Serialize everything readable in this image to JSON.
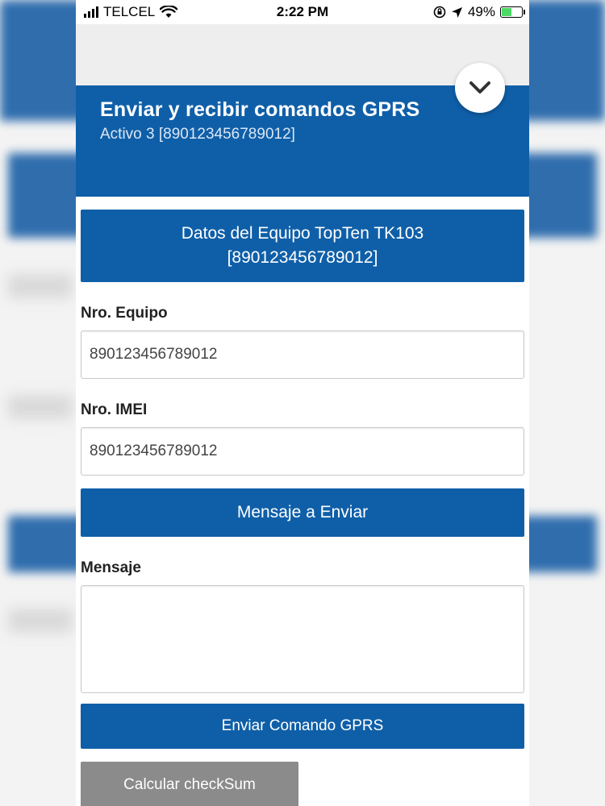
{
  "status_bar": {
    "carrier": "TELCEL",
    "time": "2:22 PM",
    "battery_percent": "49%",
    "battery_level": 0.49,
    "icons": [
      "signal-icon",
      "wifi-icon",
      "rotation-lock-icon",
      "location-icon",
      "battery-icon"
    ]
  },
  "modal": {
    "title": "Enviar y recibir comandos GPRS",
    "subtitle": "Activo 3 [890123456789012]",
    "collapse_icon": "chevron-down-icon"
  },
  "device_header": {
    "line1": "Datos del Equipo TopTen TK103",
    "line2": "[890123456789012]"
  },
  "fields": {
    "equipo_label": "Nro. Equipo",
    "equipo_value": "890123456789012",
    "imei_label": "Nro. IMEI",
    "imei_value": "890123456789012"
  },
  "message_section": {
    "header": "Mensaje a Enviar",
    "label": "Mensaje",
    "value": ""
  },
  "buttons": {
    "send": "Enviar Comando GPRS",
    "checksum": "Calcular checkSum"
  },
  "colors": {
    "primary": "#0f5fa8",
    "secondary_button": "#8b8b8b"
  }
}
